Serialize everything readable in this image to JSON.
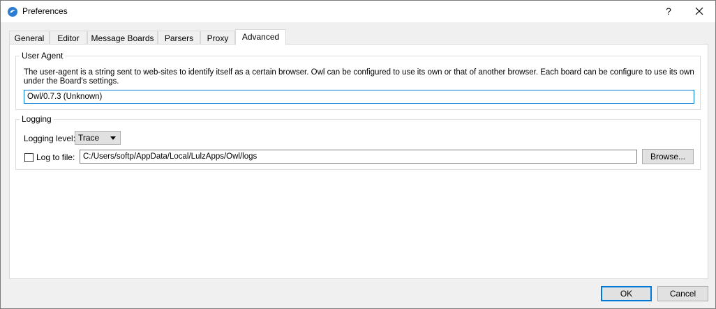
{
  "window": {
    "title": "Preferences",
    "help_label": "?"
  },
  "tabs": [
    {
      "label": "General"
    },
    {
      "label": "Editor"
    },
    {
      "label": "Message Boards"
    },
    {
      "label": "Parsers"
    },
    {
      "label": "Proxy"
    },
    {
      "label": "Advanced",
      "active": true
    }
  ],
  "user_agent": {
    "group_title": "User Agent",
    "description": "The user-agent is a string sent to web-sites to identify itself as a certain browser. Owl can be configured to use its own or that of another browser. Each board can be configure to use its own under the Board's settings.",
    "value": "Owl/0.7.3 (Unknown)"
  },
  "logging": {
    "group_title": "Logging",
    "level_label": "Logging level:",
    "level_value": "Trace",
    "log_to_file_label": "Log to file:",
    "log_to_file_checked": false,
    "path_value": "C:/Users/softp/AppData/Local/LulzApps/Owl/logs",
    "browse_label": "Browse..."
  },
  "footer": {
    "ok_label": "OK",
    "cancel_label": "Cancel"
  },
  "colors": {
    "accent": "#0078d7",
    "icon_blue": "#2b7cd3"
  }
}
